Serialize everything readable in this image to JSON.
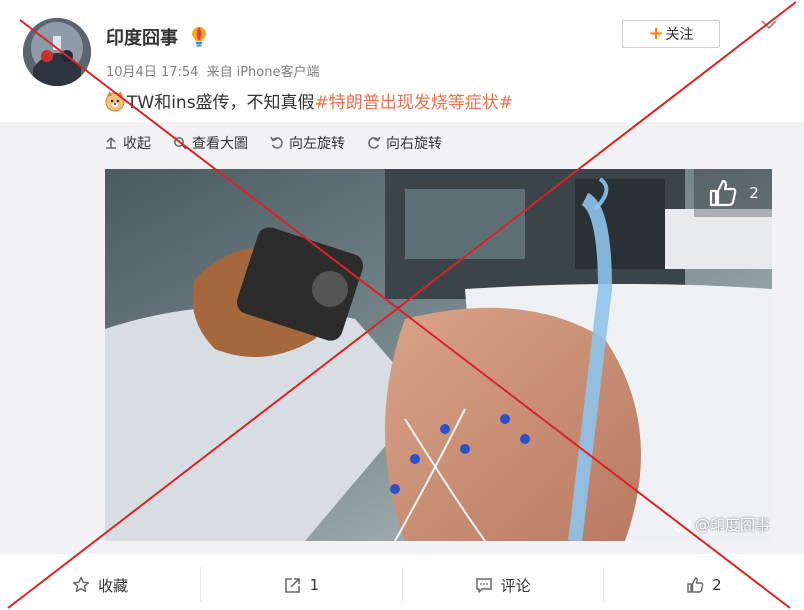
{
  "header": {
    "username": "印度囧事",
    "badge_icon": "bulb-badge-icon",
    "follow_label": "关注",
    "timestamp": "10月4日 17:54",
    "source_prefix": "来自",
    "source": "iPhone客户端"
  },
  "post": {
    "emoji_icon": "doge-emoji-icon",
    "text": "TW和ins盛传，不知真假",
    "hashtag": "#特朗普出现发烧等症状#"
  },
  "media_toolbar": {
    "collapse": "收起",
    "view_large": "查看大圖",
    "rotate_left": "向左旋转",
    "rotate_right": "向右旋转"
  },
  "photo": {
    "like_count": "2",
    "watermark": "@印度囧事"
  },
  "actions": {
    "favorite": "收藏",
    "repost_count": "1",
    "comment": "评论",
    "like_count": "2"
  },
  "colors": {
    "hashtag": "#eb7350",
    "follow_plus": "#ff8200",
    "cross": "#d8232a"
  }
}
